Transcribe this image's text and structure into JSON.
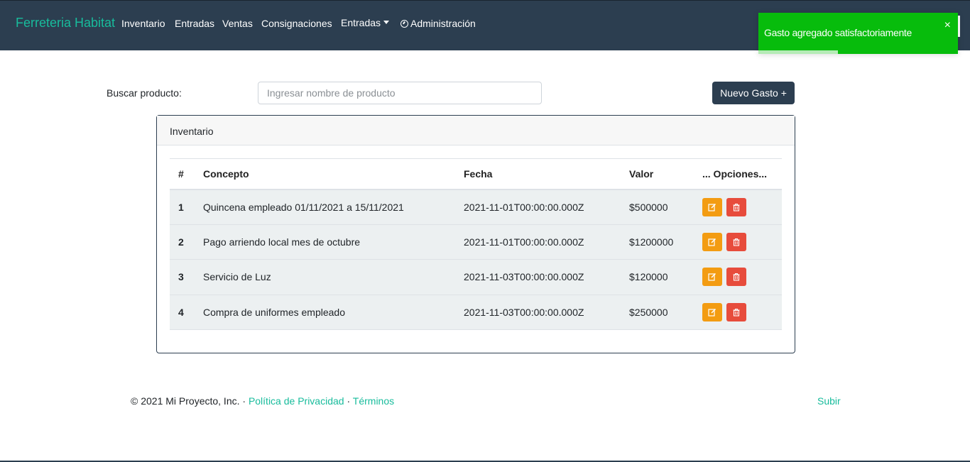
{
  "navbar": {
    "brand": "Ferreteria Habitat",
    "links": [
      "Inventario",
      "Entradas",
      "Ventas",
      "Consignaciones"
    ],
    "dropdown_label": "Entradas",
    "admin_label": "Administración",
    "bg_color": "#2c3e50",
    "brand_color": "#18bc9c"
  },
  "toast": {
    "message": "Gasto agregado satisfactoriamente",
    "close": "×",
    "bg_color": "#07bc0c",
    "progress": 0.4
  },
  "search": {
    "label": "Buscar producto:",
    "placeholder": "Ingresar nombre de producto",
    "value": ""
  },
  "new_button": "Nuevo Gasto +",
  "card": {
    "title": "Inventario",
    "headers": [
      "#",
      "Concepto",
      "Fecha",
      "Valor",
      "... Opciones..."
    ],
    "rows": [
      {
        "num": "1",
        "concepto": "Quincena empleado 01/11/2021 a 15/11/2021",
        "fecha": "2021-11-01T00:00:00.000Z",
        "valor": "$500000"
      },
      {
        "num": "2",
        "concepto": "Pago arriendo local mes de octubre",
        "fecha": "2021-11-01T00:00:00.000Z",
        "valor": "$1200000"
      },
      {
        "num": "3",
        "concepto": "Servicio de Luz",
        "fecha": "2021-11-03T00:00:00.000Z",
        "valor": "$120000"
      },
      {
        "num": "4",
        "concepto": "Compra de uniformes empleado",
        "fecha": "2021-11-03T00:00:00.000Z",
        "valor": "$250000"
      }
    ],
    "action_icons": [
      "edit-icon",
      "trash-icon"
    ]
  },
  "footer": {
    "copyright": "© 2021 Mi Proyecto, Inc. · ",
    "privacy": "Política de Privacidad",
    "separator": " · ",
    "terms": "Términos",
    "up": "Subir"
  }
}
